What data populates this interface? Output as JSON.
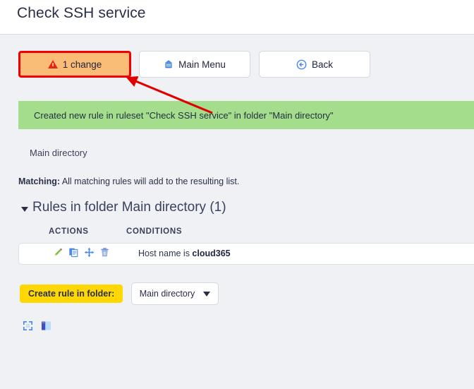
{
  "header": {
    "title": "Check SSH service"
  },
  "toolbar": {
    "changes_label": "1 change",
    "main_menu_label": "Main Menu",
    "back_label": "Back",
    "changes_icon": "warning-triangle-icon",
    "main_menu_icon": "home-icon",
    "back_icon": "back-circle-arrow-icon",
    "changes_bg": "#f9bd78",
    "changes_border": "#f00000"
  },
  "banner": {
    "message": "Created new rule in ruleset \"Check SSH service\" in folder \"Main directory\"",
    "bg": "#a4dd8c"
  },
  "breadcrumb": {
    "folder": "Main directory"
  },
  "matching": {
    "label": "Matching:",
    "text": " All matching rules will add to the resulting list."
  },
  "section": {
    "title": "Rules in folder Main directory (1)",
    "caret_icon": "caret-down-icon"
  },
  "table": {
    "columns": [
      "ACTIONS",
      "CONDITIONS"
    ],
    "action_icons": [
      "edit-pencil-icon",
      "duplicate-icon",
      "move-icon",
      "delete-trash-icon"
    ],
    "rows": [
      {
        "condition_prefix": "Host name is ",
        "condition_value": "cloud365"
      }
    ]
  },
  "create_rule": {
    "button_label": "Create rule in folder:",
    "button_bg": "#ffd703",
    "select_value": "Main directory",
    "select_icon": "caret-down-icon"
  },
  "footer": {
    "icons": [
      "expand-fullscreen-icon",
      "toggle-sidebar-icon"
    ]
  },
  "annotation": {
    "arrow_color": "#e00000"
  }
}
